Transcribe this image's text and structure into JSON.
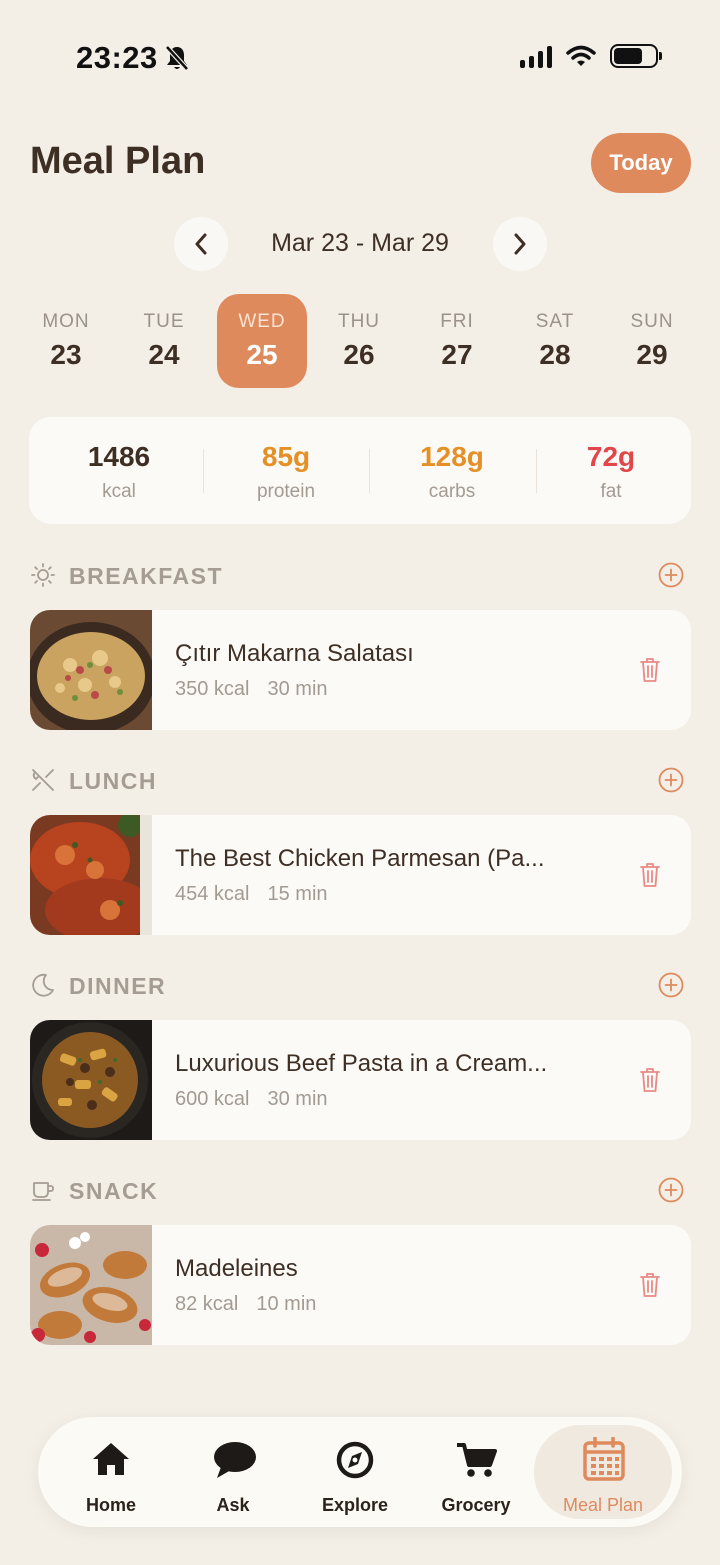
{
  "status_bar": {
    "time": "23:23"
  },
  "header": {
    "title": "Meal Plan",
    "today_label": "Today"
  },
  "week": {
    "range": "Mar 23 - Mar 29",
    "days": [
      {
        "dow": "MON",
        "num": "23"
      },
      {
        "dow": "TUE",
        "num": "24"
      },
      {
        "dow": "WED",
        "num": "25",
        "selected": true
      },
      {
        "dow": "THU",
        "num": "26"
      },
      {
        "dow": "FRI",
        "num": "27"
      },
      {
        "dow": "SAT",
        "num": "28"
      },
      {
        "dow": "SUN",
        "num": "29"
      }
    ]
  },
  "summary": {
    "kcal": {
      "value": "1486",
      "unit": "kcal",
      "color": "#3E2F25"
    },
    "protein": {
      "value": "85g",
      "unit": "protein",
      "color": "#E59027"
    },
    "carbs": {
      "value": "128g",
      "unit": "carbs",
      "color": "#E59027"
    },
    "fat": {
      "value": "72g",
      "unit": "fat",
      "color": "#E0464A"
    }
  },
  "meals": {
    "breakfast": {
      "label": "BREAKFAST",
      "icon": "sun-icon",
      "name": "Çıtır Makarna Salatası",
      "kcal": "350 kcal",
      "time": "30 min"
    },
    "lunch": {
      "label": "LUNCH",
      "icon": "utensils-icon",
      "name": "The Best Chicken Parmesan (Pa...",
      "kcal": "454 kcal",
      "time": "15 min"
    },
    "dinner": {
      "label": "DINNER",
      "icon": "moon-icon",
      "name": "Luxurious Beef Pasta in a Cream...",
      "kcal": "600 kcal",
      "time": "30 min"
    },
    "snack": {
      "label": "SNACK",
      "icon": "cup-icon",
      "name": "Madeleines",
      "kcal": "82 kcal",
      "time": "10 min"
    }
  },
  "tabs": {
    "home": "Home",
    "ask": "Ask",
    "explore": "Explore",
    "grocery": "Grocery",
    "meal_plan": "Meal Plan"
  },
  "colors": {
    "accent": "#DE8A5C",
    "background": "#F3EFE7",
    "card": "#FCFAF7"
  }
}
